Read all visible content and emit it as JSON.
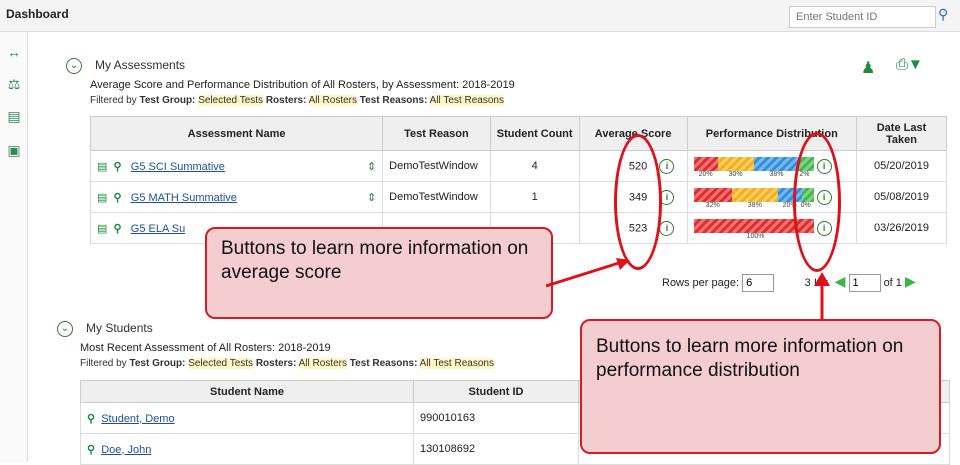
{
  "topbar": {
    "title": "Dashboard",
    "search_placeholder": "Enter Student ID"
  },
  "assessments": {
    "title": "My Assessments",
    "subtitle": "Average Score and Performance Distribution of All Rosters, by Assessment: 2018-2019",
    "filter_prefix": "Filtered by",
    "test_group_label": "Test Group:",
    "test_group_value": "Selected Tests",
    "rosters_label": "Rosters:",
    "rosters_value": "All Rosters",
    "reasons_label": "Test Reasons:",
    "reasons_value": "All Test Reasons",
    "columns": [
      "Assessment Name",
      "Test Reason",
      "Student Count",
      "Average Score",
      "Performance Distribution",
      "Date Last Taken"
    ],
    "rows": [
      {
        "name": "G5 SCI Summative",
        "reason": "DemoTestWindow",
        "count": "4",
        "avg": "520",
        "date": "05/20/2019",
        "dist": [
          {
            "pct": 20,
            "label": "20%",
            "color": "#e32a2a"
          },
          {
            "pct": 30,
            "label": "30%",
            "color": "#f5b018"
          },
          {
            "pct": 38,
            "label": "38%",
            "color": "#2f8fe0"
          },
          {
            "pct": 12,
            "label": "2%",
            "color": "#41b94a"
          }
        ]
      },
      {
        "name": "G5 MATH Summative",
        "reason": "DemoTestWindow",
        "count": "1",
        "avg": "349",
        "date": "05/08/2019",
        "dist": [
          {
            "pct": 32,
            "label": "32%",
            "color": "#e32a2a"
          },
          {
            "pct": 38,
            "label": "38%",
            "color": "#f5b018"
          },
          {
            "pct": 20,
            "label": "20%",
            "color": "#2f8fe0"
          },
          {
            "pct": 10,
            "label": "0%",
            "color": "#41b94a"
          }
        ]
      },
      {
        "name": "G5 ELA Su",
        "reason": "",
        "count": "",
        "avg": "523",
        "date": "03/26/2019",
        "dist": [
          {
            "pct": 100,
            "label": "100%",
            "color": "#e32a2a"
          }
        ]
      }
    ],
    "rows_per_page_label": "Rows per page:",
    "rows_per_page_value": "6",
    "items_label": "3 It",
    "items_label_tail": "s:",
    "page_value": "1",
    "page_of": "of 1"
  },
  "students": {
    "title": "My Students",
    "subtitle": "Most Recent Assessment of All Rosters: 2018-2019",
    "columns": [
      "Student Name",
      "Student ID"
    ],
    "rows": [
      {
        "name": "Student, Demo",
        "id": "990010163"
      },
      {
        "name": "Doe, John",
        "id": "130108692"
      }
    ]
  },
  "callouts": {
    "avg": "Buttons to learn more information on average score",
    "perf": "Buttons to learn more information on performance distribution"
  },
  "colors": {
    "accent": "#d41c24",
    "callout_bg": "#f4cdd0",
    "link": "#1f4f96"
  }
}
